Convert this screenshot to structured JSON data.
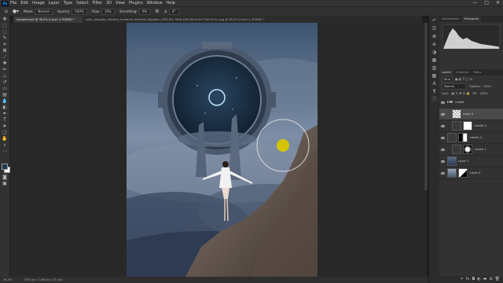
{
  "menu": {
    "logo": "Ps",
    "items": [
      "File",
      "Edit",
      "Image",
      "Layer",
      "Type",
      "Select",
      "Filter",
      "3D",
      "View",
      "Plugins",
      "Window",
      "Help"
    ]
  },
  "window_controls": [
    "—",
    "□",
    "✕"
  ],
  "options": {
    "mode_label": "Mode:",
    "mode_value": "Normal",
    "opacity_label": "Opacity:",
    "opacity_value": "100%",
    "flow_label": "Flow:",
    "flow_value": "10%",
    "smoothing_label": "Smoothing:",
    "smoothing_value": "0%",
    "angle_value": "0°"
  },
  "tabs": [
    {
      "label": "stargate.psd @ 36,5% (Layer 4, RGB/8) *",
      "active": true
    },
    {
      "label": "color_stargate_detailed_rendered_ethereal_stargate_29f51f54-78b6-4f34-85c8-4d77c6e7fc3c.png @ 36,5% (Layer 0, RGB/8) *",
      "active": false
    }
  ],
  "status": {
    "zoom": "36,5%",
    "doc": "1920 px x 1080 px (72 ppi)"
  },
  "panel_tabs_top": [
    "Adjustments",
    "Histogram"
  ],
  "panel_tabs_layers": [
    "Layers",
    "Channels",
    "Paths"
  ],
  "layers_ctrl": {
    "kind": "Kind",
    "blend": "Normal",
    "opacity_label": "Opacity:",
    "opacity_value": "100%",
    "lock_label": "Lock:",
    "fill_label": "Fill:",
    "fill_value": "100%"
  },
  "layers": [
    {
      "name": "model",
      "type": "group",
      "selected": false
    },
    {
      "name": "Layer 4",
      "type": "layer",
      "selected": true
    },
    {
      "name": "Levels 3",
      "type": "adjustment",
      "selected": false
    },
    {
      "name": "Levels 2...",
      "type": "adjustment",
      "selected": false
    },
    {
      "name": "Levels 1",
      "type": "adjustment",
      "selected": false
    },
    {
      "name": "Layer 1",
      "type": "layer",
      "selected": false
    },
    {
      "name": "Layer 0",
      "type": "layer",
      "selected": false
    }
  ],
  "colors": {
    "foreground": "#1c3850",
    "background": "#ffffff",
    "brush_cursor": "#d4c400",
    "accent": "#31a8ff"
  }
}
